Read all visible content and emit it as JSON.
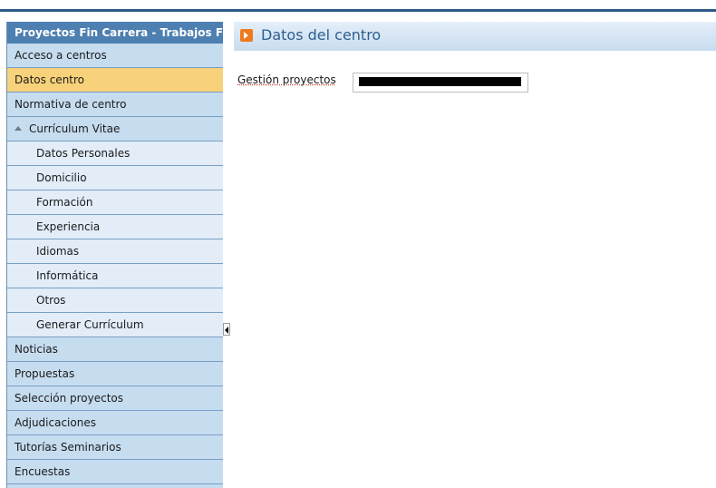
{
  "sidebar": {
    "header": "Proyectos Fin Carrera - Trabajos Fin Grado",
    "items": [
      {
        "label": "Acceso a centros",
        "state": "normal"
      },
      {
        "label": "Datos centro",
        "state": "active"
      },
      {
        "label": "Normativa de centro",
        "state": "normal"
      },
      {
        "label": "Currículum Vitae",
        "state": "expanded"
      },
      {
        "label": "Datos Personales",
        "state": "sub"
      },
      {
        "label": "Domicilio",
        "state": "sub"
      },
      {
        "label": "Formación",
        "state": "sub"
      },
      {
        "label": "Experiencia",
        "state": "sub"
      },
      {
        "label": "Idiomas",
        "state": "sub"
      },
      {
        "label": "Informática",
        "state": "sub"
      },
      {
        "label": "Otros",
        "state": "sub"
      },
      {
        "label": "Generar Currículum",
        "state": "sub"
      },
      {
        "label": "Noticias",
        "state": "normal"
      },
      {
        "label": "Propuestas",
        "state": "normal"
      },
      {
        "label": "Selección proyectos",
        "state": "normal"
      },
      {
        "label": "Adjudicaciones",
        "state": "normal"
      },
      {
        "label": "Tutorías Seminarios",
        "state": "normal"
      },
      {
        "label": "Encuestas",
        "state": "normal"
      }
    ]
  },
  "main": {
    "title": "Datos del centro",
    "field_label": "Gestión proyectos",
    "field_value": ""
  },
  "colors": {
    "active_item": "#f8d27a",
    "header_bg": "#4d7fb1",
    "title_text": "#2f5f8d",
    "icon_orange": "#ef7a1e"
  },
  "icons": {
    "page_title": "orange-arrow-icon",
    "expand": "triangle-up-icon",
    "collapse": "collapse-left-arrow-icon"
  }
}
